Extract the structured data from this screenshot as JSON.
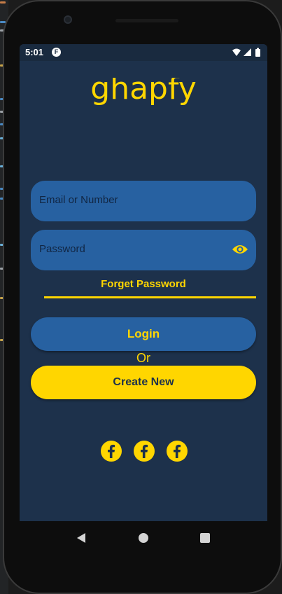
{
  "theme": {
    "background": "#1d314b",
    "field": "#2761a1",
    "accent": "#ffd600",
    "status_bar": "#192a3f"
  },
  "status_bar": {
    "time": "5:01",
    "app_icon_letter": "F",
    "icons": [
      "wifi-icon",
      "signal-icon",
      "battery-icon"
    ]
  },
  "logo": {
    "text": "ghapfy"
  },
  "form": {
    "email_placeholder": "Email or Number",
    "password_placeholder": "Password",
    "password_toggle_icon": "eye-icon",
    "forget_label": "Forget Password",
    "login_label": "Login",
    "or_label": "Or",
    "create_label": "Create New"
  },
  "social": {
    "buttons": [
      {
        "icon": "facebook-icon"
      },
      {
        "icon": "facebook-icon"
      },
      {
        "icon": "facebook-icon"
      }
    ]
  },
  "nav_bar": {
    "icons": [
      "back-icon",
      "home-icon",
      "recents-icon"
    ]
  }
}
